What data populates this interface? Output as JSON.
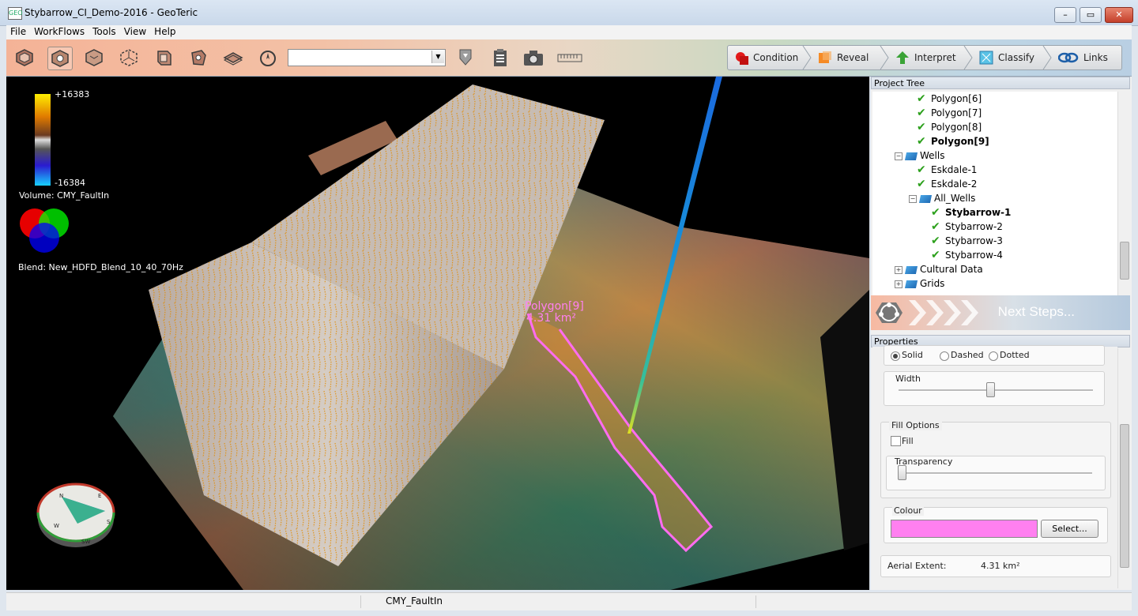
{
  "window": {
    "app_icon": "GEO",
    "title": "Stybarrow_CI_Demo-2016 - GeoTeric"
  },
  "menu": [
    "File",
    "WorkFlows",
    "Tools",
    "View",
    "Help"
  ],
  "toolbar": {
    "icons": [
      "volume-view-icon",
      "cube-view-icon",
      "horizon-cube-icon",
      "cube-axes-icon",
      "section-view-icon",
      "probe-icon",
      "well-log-icon",
      "compass-tool-icon"
    ],
    "combo_value": "",
    "extra_icons": [
      "polygon-pin-icon",
      "clipboard-icon",
      "camera-icon",
      "ruler-icon"
    ]
  },
  "workflow": {
    "condition": "Condition",
    "reveal": "Reveal",
    "interpret": "Interpret",
    "classify": "Classify",
    "links": "Links"
  },
  "viewport": {
    "colorbar_max": "+16383",
    "colorbar_min": "-16384",
    "volume_label": "Volume: CMY_FaultIn",
    "blend_label": "Blend: New_HDFD_Blend_10_40_70Hz",
    "polygon_label": "Polygon[9]",
    "polygon_area": "4.31 km²",
    "compass": {
      "n": "N",
      "e": "E",
      "s": "S",
      "w": "W",
      "sw": "SW"
    }
  },
  "project_tree": {
    "header": "Project Tree",
    "nodes": [
      {
        "label": "Polygon[6]",
        "bold": false
      },
      {
        "label": "Polygon[7]",
        "bold": false
      },
      {
        "label": "Polygon[8]",
        "bold": false
      },
      {
        "label": "Polygon[9]",
        "bold": true
      },
      {
        "label": "Wells",
        "bold": false
      },
      {
        "label": "Eskdale-1",
        "bold": false
      },
      {
        "label": "Eskdale-2",
        "bold": false
      },
      {
        "label": "All_Wells",
        "bold": false
      },
      {
        "label": "Stybarrow-1",
        "bold": true
      },
      {
        "label": "Stybarrow-2",
        "bold": false
      },
      {
        "label": "Stybarrow-3",
        "bold": false
      },
      {
        "label": "Stybarrow-4",
        "bold": false
      },
      {
        "label": "Cultural Data",
        "bold": false
      },
      {
        "label": "Grids",
        "bold": false
      }
    ]
  },
  "next_steps": "Next Steps...",
  "properties": {
    "header": "Properties",
    "line_style": {
      "solid": "Solid",
      "dashed": "Dashed",
      "dotted": "Dotted",
      "selected": "Solid"
    },
    "width_label": "Width",
    "width_value": 0.47,
    "fill_options": "Fill Options",
    "fill_label": "Fill",
    "transparency_label": "Transparency",
    "transparency_value": 0.0,
    "colour_label": "Colour",
    "colour_hex": "#ff80f0",
    "select_button": "Select...",
    "aerial_label": "Aerial Extent:",
    "aerial_value": "4.31 km²"
  },
  "status": {
    "text": "CMY_FaultIn"
  }
}
